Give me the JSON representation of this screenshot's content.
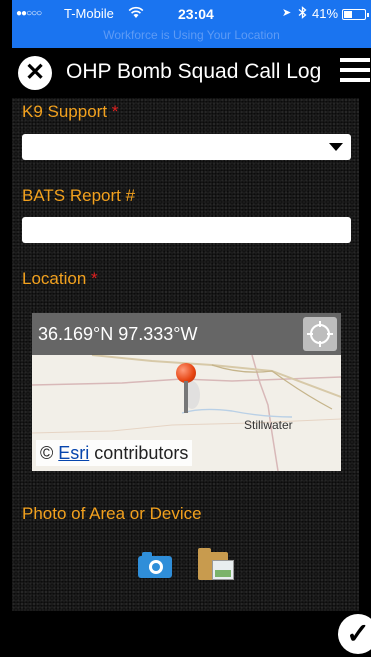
{
  "status_bar": {
    "signal": "●●○○○",
    "carrier": "T-Mobile",
    "wifi_icon": "wifi-icon",
    "time": "23:04",
    "battery": "41%",
    "battery_level": 0.41,
    "banner": "Workforce is Using Your Location"
  },
  "header": {
    "close_label": "✕",
    "title": "OHP Bomb Squad Call Log",
    "menu_icon": "hamburger-menu-icon"
  },
  "form": {
    "k9_label": "K9 Support",
    "k9_required": "*",
    "k9_value": "",
    "bats_label": "BATS Report #",
    "bats_value": "",
    "location_label": "Location",
    "location_required": "*",
    "coordinates": "36.169°N 97.333°W",
    "map_place_label": "Stillwater",
    "attribution_prefix": "©",
    "attribution_link": "Esri",
    "attribution_suffix": "contributors",
    "photo_label": "Photo of Area or Device"
  },
  "footer": {
    "submit_label": "✓"
  },
  "colors": {
    "status_bar_bg": "#1a74f0",
    "label": "#f2a11e",
    "required": "#e02020",
    "pin": "#e64310"
  }
}
